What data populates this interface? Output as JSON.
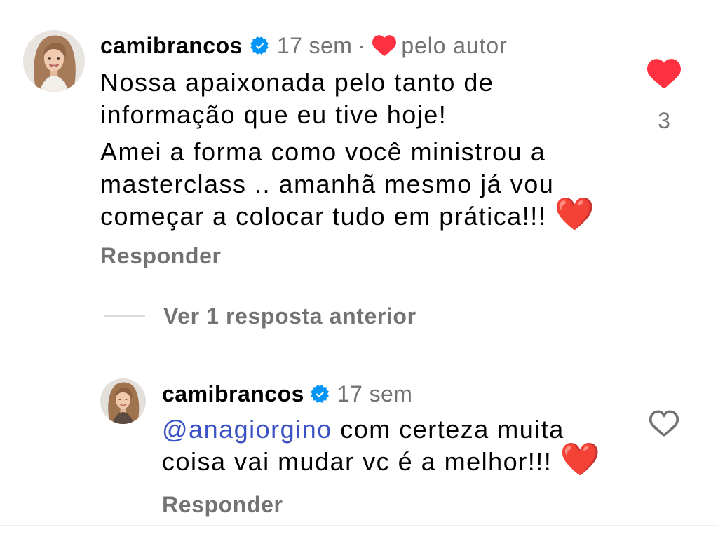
{
  "comment": {
    "username": "camibrancos",
    "verified": true,
    "time": "17 sem",
    "separator": "·",
    "liked_by_author": true,
    "liked_by_author_label": "pelo autor",
    "paragraphs": [
      "Nossa apaixonada pelo tanto de informação que eu tive hoje!",
      "Amei a forma como você ministrou a masterclass .. amanhã mesmo já vou começar a colocar tudo em prática!!!"
    ],
    "emoji": "❤️",
    "reply_label": "Responder",
    "liked": true,
    "like_count": 3
  },
  "thread": {
    "view_previous_label": "Ver 1 resposta anterior"
  },
  "reply": {
    "username": "camibrancos",
    "verified": true,
    "time": "17 sem",
    "mention": "@anagiorgino",
    "text": "com certeza muita coisa vai mudar vc é a melhor!!!",
    "emoji": "❤️",
    "reply_label": "Responder",
    "liked": false
  },
  "icons": {
    "verified": "verified-badge-icon",
    "liked_by_author": "heart-filled-icon",
    "comment_like": "heart-filled-icon",
    "reply_like": "heart-outline-icon"
  },
  "colors": {
    "text": "#000000",
    "secondary": "#737373",
    "like_red": "#ff3040",
    "verified_blue": "#0095f6",
    "mention_blue": "#3b52c4",
    "emoji_red": "#e3262e",
    "divider": "#dbdbdb"
  }
}
